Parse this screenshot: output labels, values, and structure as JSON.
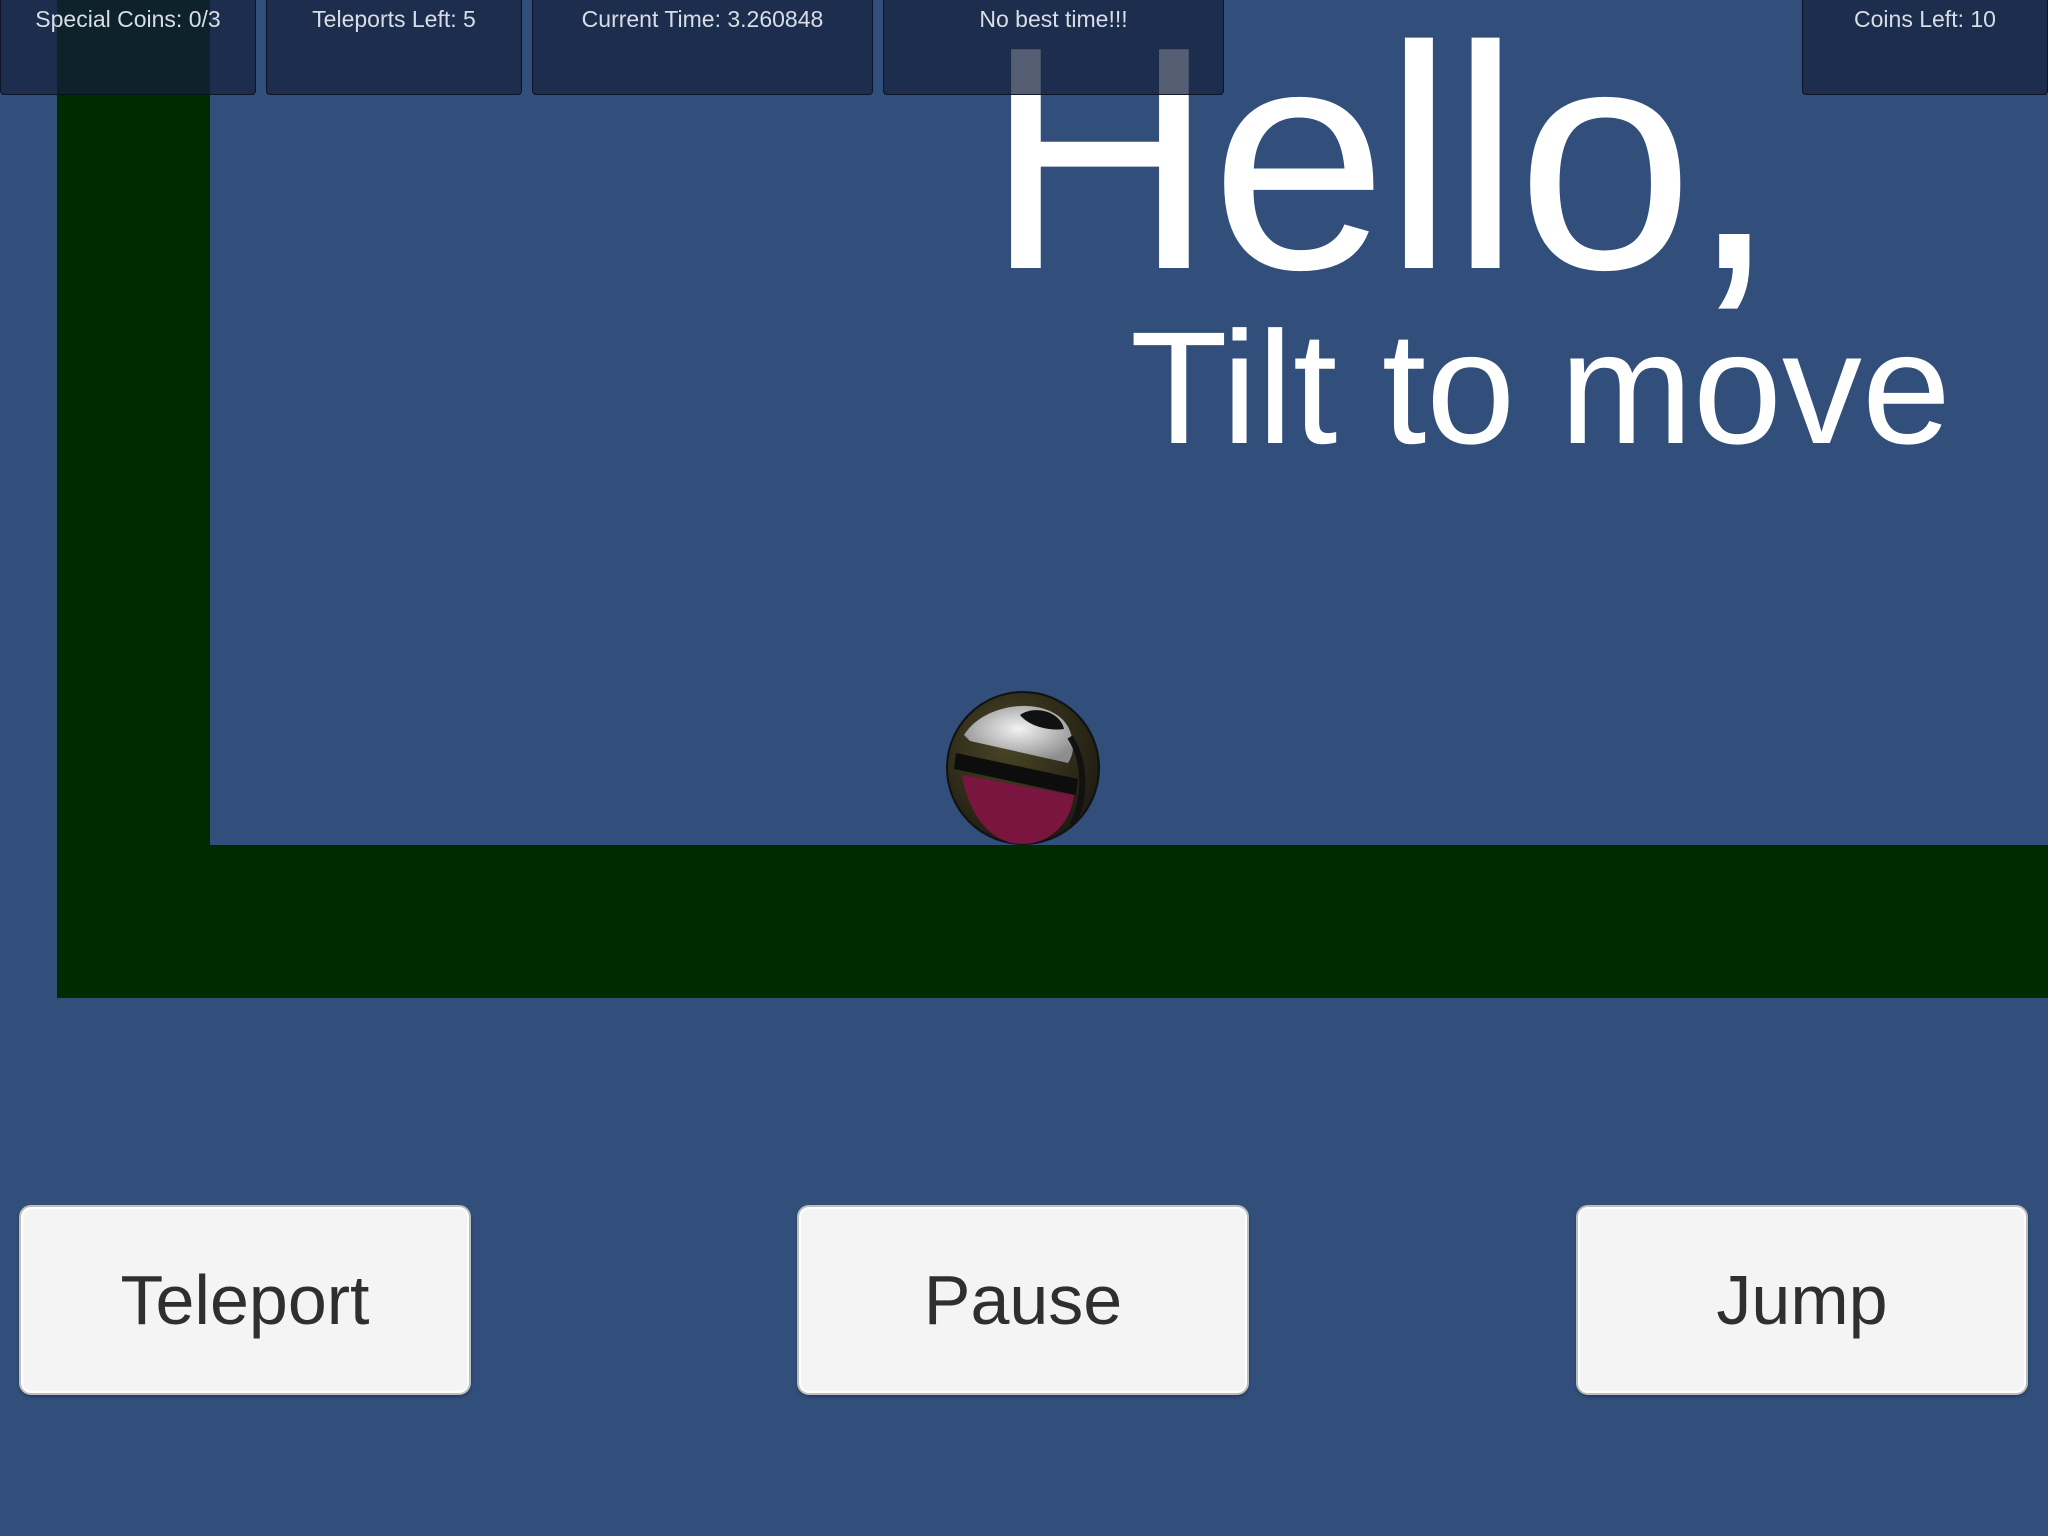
{
  "hud": {
    "special_coins": "Special Coins: 0/3",
    "teleports_left": "Teleports Left: 5",
    "current_time": "Current Time: 3.260848",
    "best_time": "No best time!!!",
    "coins_left": "Coins Left: 10"
  },
  "message": {
    "greeting": "Hello,",
    "instruction": "Tilt to move"
  },
  "buttons": {
    "teleport": "Teleport",
    "pause": "Pause",
    "jump": "Jump"
  },
  "colors": {
    "background": "#324f7b",
    "wall": "#002a00",
    "text": "#ffffff",
    "button_bg": "#f4f4f4",
    "button_text": "#2f2f2f"
  }
}
